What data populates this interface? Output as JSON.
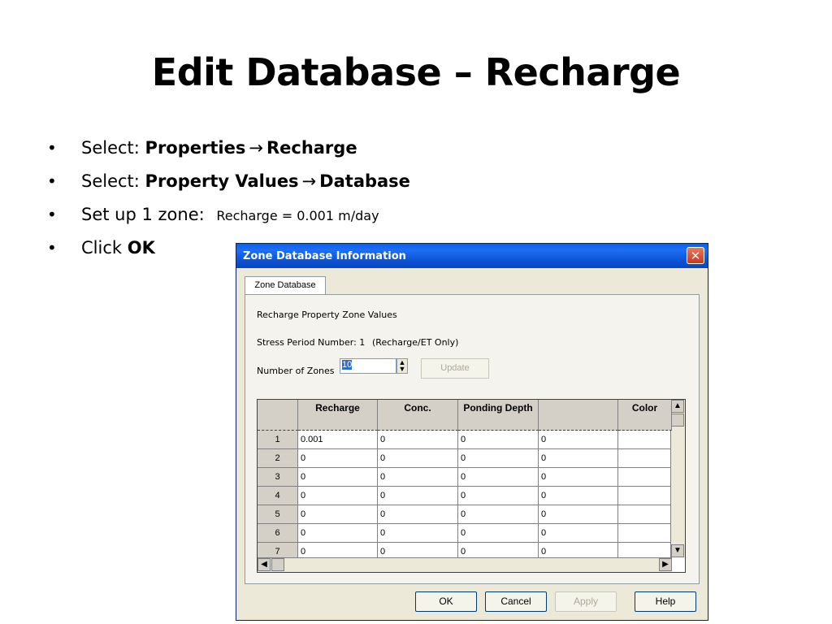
{
  "slide": {
    "title": "Edit Database – Recharge",
    "bullets": [
      {
        "bullet": "•",
        "prefix": "Select: ",
        "bold1": "Properties",
        "arrow": "→",
        "bold2": "Recharge",
        "small": ""
      },
      {
        "bullet": "•",
        "prefix": "Select: ",
        "bold1": "Property Values",
        "arrow": "→",
        "bold2": "Database",
        "small": ""
      },
      {
        "bullet": "•",
        "prefix": "Set up 1 zone: ",
        "bold1": "",
        "arrow": "",
        "bold2": "",
        "small": "Recharge = 0.001 m/day"
      },
      {
        "bullet": "•",
        "prefix": "Click ",
        "bold1": "OK",
        "arrow": "",
        "bold2": "",
        "small": ""
      }
    ]
  },
  "dialog": {
    "title": "Zone Database Information",
    "close_glyph": "✕",
    "tab_label": "Zone Database",
    "heading": "Recharge Property Zone Values",
    "stress_period": "Stress Period Number: 1",
    "stress_note": "(Recharge/ET Only)",
    "zones_label": "Number of Zones",
    "zones_value": "10",
    "update_label": "Update",
    "grid": {
      "headers": [
        "",
        "Recharge",
        "Conc.",
        "Ponding Depth",
        "",
        "Color"
      ],
      "rows": [
        [
          "1",
          "0.001",
          "0",
          "0",
          "0",
          ""
        ],
        [
          "2",
          "0",
          "0",
          "0",
          "0",
          ""
        ],
        [
          "3",
          "0",
          "0",
          "0",
          "0",
          ""
        ],
        [
          "4",
          "0",
          "0",
          "0",
          "0",
          ""
        ],
        [
          "5",
          "0",
          "0",
          "0",
          "0",
          ""
        ],
        [
          "6",
          "0",
          "0",
          "0",
          "0",
          ""
        ],
        [
          "7",
          "0",
          "0",
          "0",
          "0",
          ""
        ]
      ]
    },
    "buttons": {
      "ok": "OK",
      "cancel": "Cancel",
      "apply": "Apply",
      "help": "Help"
    }
  }
}
